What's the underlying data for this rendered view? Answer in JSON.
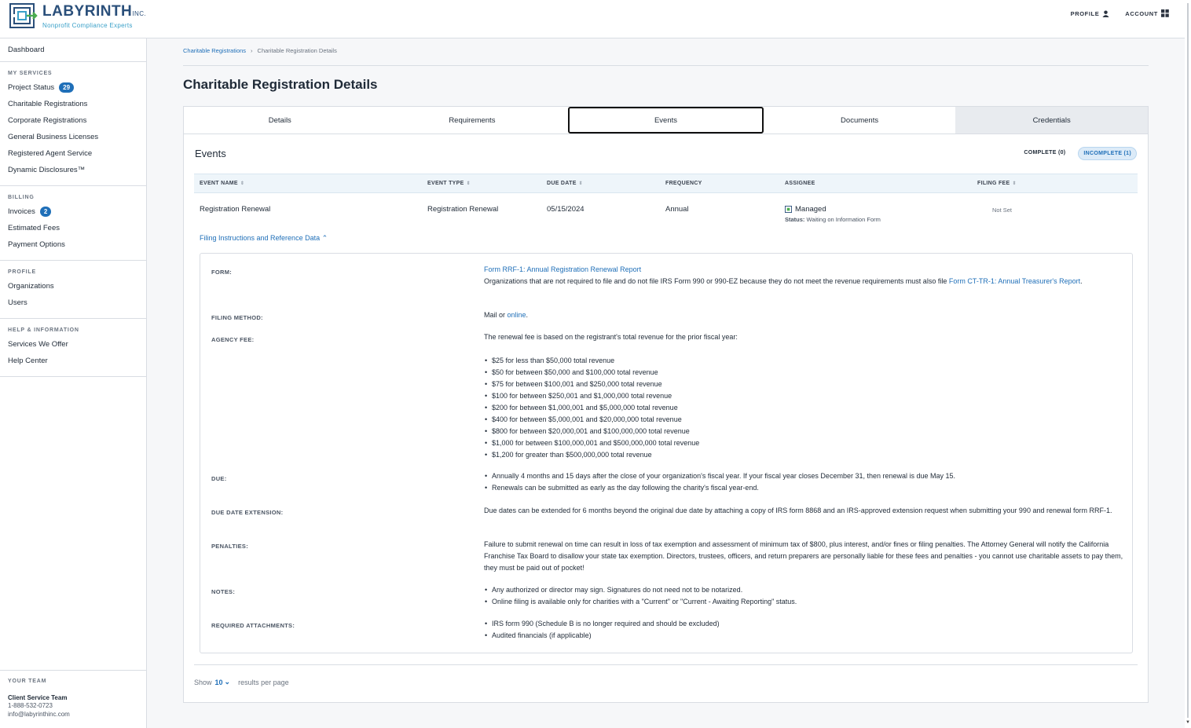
{
  "header": {
    "logo_title": "LABYRINTH",
    "logo_inc": "INC.",
    "logo_sub": "Nonprofit Compliance Experts",
    "nav": [
      {
        "label": "PROFILE",
        "icon": "user-icon"
      },
      {
        "label": "ACCOUNT",
        "icon": "grid-icon"
      }
    ]
  },
  "sidebar": {
    "dashboard": "Dashboard",
    "my_services": {
      "heading": "MY SERVICES",
      "items": [
        {
          "label": "Project Status",
          "badge": "29"
        },
        {
          "label": "Charitable Registrations"
        },
        {
          "label": "Corporate Registrations"
        },
        {
          "label": "General Business Licenses"
        },
        {
          "label": "Registered Agent Service"
        },
        {
          "label": "Dynamic Disclosures™"
        }
      ]
    },
    "billing": {
      "heading": "BILLING",
      "items": [
        {
          "label": "Invoices",
          "badge": "2"
        },
        {
          "label": "Estimated Fees"
        },
        {
          "label": "Payment Options"
        }
      ]
    },
    "profile": {
      "heading": "PROFILE",
      "items": [
        {
          "label": "Organizations"
        },
        {
          "label": "Users"
        }
      ]
    },
    "help": {
      "heading": "HELP & INFORMATION",
      "items": [
        {
          "label": "Services We Offer"
        },
        {
          "label": "Help Center"
        }
      ]
    },
    "team": {
      "heading": "YOUR TEAM",
      "name": "Client Service Team",
      "phone": "1-888-532-0723",
      "email": "info@labyrinthinc.com"
    }
  },
  "breadcrumb": {
    "parent": "Charitable Registrations",
    "separator": "›",
    "current": "Charitable Registration Details"
  },
  "page_title": "Charitable Registration Details",
  "tabs": [
    {
      "label": "Details"
    },
    {
      "label": "Requirements"
    },
    {
      "label": "Events",
      "active": true
    },
    {
      "label": "Documents"
    },
    {
      "label": "Credentials"
    }
  ],
  "events": {
    "heading": "Events",
    "filters": {
      "complete": "COMPLETE (0)",
      "incomplete": "INCOMPLETE (1)"
    },
    "columns": {
      "name": "EVENT NAME",
      "type": "EVENT TYPE",
      "due": "DUE DATE",
      "frequency": "FREQUENCY",
      "assignee": "ASSIGNEE",
      "fee": "FILING FEE"
    },
    "row": {
      "name": "Registration Renewal",
      "type": "Registration Renewal",
      "due": "05/15/2024",
      "frequency": "Annual",
      "assignee": "Managed",
      "status_label": "Status:",
      "status_value": "Waiting on Information Form",
      "fee": "Not Set"
    },
    "toggle_label": "Filing Instructions and Reference Data"
  },
  "filing": {
    "form_label": "FORM:",
    "form_link": "Form RRF-1: Annual Registration Renewal Report",
    "form_text": "Organizations that are not required to file and do not file IRS Form 990 or 990-EZ because they do not meet the revenue requirements must also file ",
    "form_link2": "Form CT-TR-1: Annual Treasurer's Report",
    "form_end": ".",
    "method_label": "FILING METHOD:",
    "method_text": "Mail or ",
    "method_link": "online",
    "method_end": ".",
    "fee_label": "AGENCY FEE:",
    "fee_intro": "The renewal fee is based on the registrant's total revenue for the prior fiscal year:",
    "fees": [
      "$25 for less than $50,000 total revenue",
      "$50 for between $50,000 and $100,000 total revenue",
      "$75 for between $100,001 and $250,000 total revenue",
      "$100 for between $250,001 and $1,000,000 total revenue",
      "$200 for between $1,000,001 and $5,000,000 total revenue",
      "$400 for between $5,000,001 and $20,000,000 total revenue",
      "$800 for between $20,000,001 and $100,000,000 total revenue",
      "$1,000 for between $100,000,001 and $500,000,000 total revenue",
      "$1,200 for greater than $500,000,000 total revenue"
    ],
    "due_label": "DUE:",
    "due_items": [
      "Annually 4 months and 15 days after the close of your organization's fiscal year. If your fiscal year closes December 31, then renewal is due May 15.",
      "Renewals can be submitted as early as the day following the charity's fiscal year-end."
    ],
    "ext_label": "DUE DATE EXTENSION:",
    "ext_text": "Due dates can be extended for 6 months beyond the original due date by attaching a copy of IRS form 8868 and an IRS-approved extension request when submitting your 990 and renewal form RRF-1.",
    "pen_label": "PENALTIES:",
    "pen_text": "Failure to submit renewal on time can result in loss of tax exemption and assessment of minimum tax of $800, plus interest, and/or fines or filing penalties. The Attorney General will notify the California Franchise Tax Board to disallow your state tax exemption. Directors, trustees, officers, and return preparers are personally liable for these fees and penalties - you cannot use charitable assets to pay them, they must be paid out of pocket!",
    "notes_label": "NOTES:",
    "notes": [
      "Any authorized or director may sign. Signatures do not need not to be notarized.",
      "Online filing is available only for charities with a \"Current\" or \"Current - Awaiting Reporting\" status."
    ],
    "att_label": "REQUIRED ATTACHMENTS:",
    "attachments": [
      "IRS form 990 (Schedule B is no longer required and should be excluded)",
      "Audited financials (if applicable)"
    ]
  },
  "pagination": {
    "show": "Show",
    "value": "10",
    "suffix": "results per page"
  },
  "colors": {
    "brand": "#2a4f7a",
    "accent": "#1f6fb8",
    "badge": "#1f6fb8"
  }
}
